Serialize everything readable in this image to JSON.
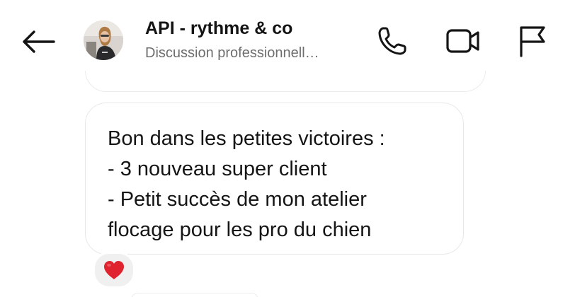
{
  "header": {
    "title": "API - rythme & co",
    "subtitle": "Discussion professionnell…",
    "back_icon": "arrow-left-icon",
    "call_icon": "phone-icon",
    "video_icon": "video-camera-icon",
    "flag_icon": "flag-icon"
  },
  "message": {
    "lines": [
      "Bon dans les petites victoires :",
      "- 3 nouveau super client",
      "- Petit succès de mon atelier",
      "flocage pour les pro du chien"
    ],
    "reaction": "❤️",
    "reaction_icon": "heart-icon"
  },
  "colors": {
    "bubble_border": "#e8e8e8",
    "subtitle": "#6e6e6e",
    "heart": "#e0242f",
    "reaction_bg": "#f0f0f0"
  }
}
